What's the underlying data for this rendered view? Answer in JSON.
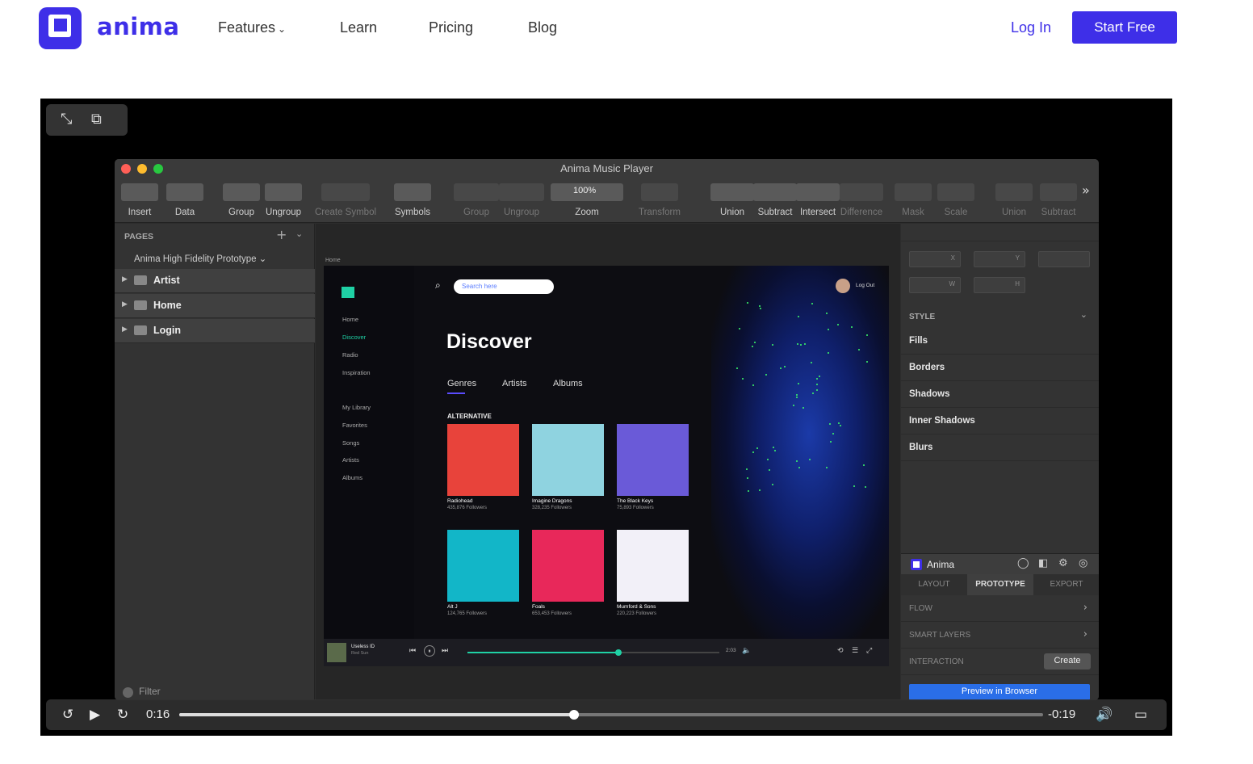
{
  "header": {
    "brand": "anima",
    "nav": [
      "Features",
      "Learn",
      "Pricing",
      "Blog"
    ],
    "login": "Log In",
    "start": "Start Free"
  },
  "mac": {
    "title": "Anima Music Player",
    "toolbar": [
      {
        "label": "Insert",
        "dim": false
      },
      {
        "label": "Data",
        "dim": false
      },
      {
        "label": "Group",
        "dim": false
      },
      {
        "label": "Ungroup",
        "dim": false
      },
      {
        "label": "Create Symbol",
        "dim": true
      },
      {
        "label": "Symbols",
        "dim": false
      },
      {
        "label": "Group",
        "dim": true
      },
      {
        "label": "Ungroup",
        "dim": true
      },
      {
        "label": "Zoom",
        "dim": false
      },
      {
        "label": "Transform",
        "dim": true
      },
      {
        "label": "Union",
        "dim": false
      },
      {
        "label": "Subtract",
        "dim": false
      },
      {
        "label": "Intersect",
        "dim": false
      },
      {
        "label": "Difference",
        "dim": true
      },
      {
        "label": "Mask",
        "dim": true
      },
      {
        "label": "Scale",
        "dim": true
      },
      {
        "label": "Union",
        "dim": true
      },
      {
        "label": "Subtract",
        "dim": true
      }
    ],
    "zoom_value": "100%",
    "pages_label": "PAGES",
    "prototype_name": "Anima High Fidelity Prototype",
    "pages": [
      "Artist",
      "Home",
      "Login"
    ],
    "filter": "Filter"
  },
  "app": {
    "breadcrumb": "Home",
    "search_placeholder": "Search here",
    "logout": "Log Out",
    "nav": [
      "Home",
      "Discover",
      "Radio",
      "Inspiration"
    ],
    "library": [
      "My Library",
      "Favorites",
      "Songs",
      "Artists",
      "Albums"
    ],
    "heading": "Discover",
    "tabs": [
      "Genres",
      "Artists",
      "Albums"
    ],
    "section": "ALTERNATIVE",
    "albums": [
      {
        "name": "Radiohead",
        "followers": "435,876 Followers",
        "color": "#e8433b"
      },
      {
        "name": "Imagine Dragons",
        "followers": "328,235 Followers",
        "color": "#8fd3e0"
      },
      {
        "name": "The Black Keys",
        "followers": "75,893 Followers",
        "color": "#6a5ad8"
      },
      {
        "name": "Alt J",
        "followers": "124,765 Followers",
        "color": "#12b6c8"
      },
      {
        "name": "Foals",
        "followers": "653,453 Followers",
        "color": "#e8285a"
      },
      {
        "name": "Mumford & Sons",
        "followers": "220,223 Followers",
        "color": "#f2f0f8"
      }
    ],
    "player": {
      "title": "Useless ID",
      "subtitle": "Red Sun",
      "time": "2:03",
      "progress": 0.6
    }
  },
  "inspector": {
    "fields": [
      "X",
      "Y",
      "W",
      "H"
    ],
    "style_label": "STYLE",
    "sections": [
      "Fills",
      "Borders",
      "Shadows",
      "Inner Shadows",
      "Blurs"
    ],
    "plugin": "Anima",
    "tabs": [
      "LAYOUT",
      "PROTOTYPE",
      "EXPORT"
    ],
    "rows": [
      "FLOW",
      "SMART LAYERS",
      "INTERACTION"
    ],
    "create": "Create",
    "preview": "Preview in Browser"
  },
  "video": {
    "elapsed": "0:16",
    "remaining": "-0:19",
    "progress": 0.457
  },
  "colors": {
    "accent": "#3e2fe8",
    "teal": "#1fd1a5"
  }
}
